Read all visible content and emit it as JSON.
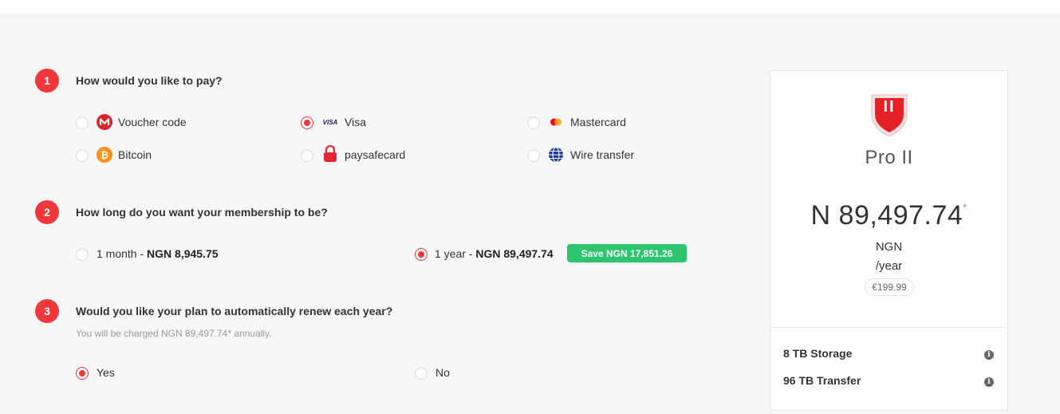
{
  "steps": [
    {
      "number": "1",
      "title": "How would you like to pay?"
    },
    {
      "number": "2",
      "title": "How long do you want your membership to be?"
    },
    {
      "number": "3",
      "title": "Would you like your plan to automatically renew each year?",
      "subtitle": "You will be charged NGN 89,497.74* annually."
    }
  ],
  "payment_methods": [
    {
      "label": "Voucher code",
      "icon": "mega-logo-icon",
      "selected": false
    },
    {
      "label": "Visa",
      "icon": "visa-logo-icon",
      "selected": true
    },
    {
      "label": "Mastercard",
      "icon": "mastercard-logo-icon",
      "selected": false
    },
    {
      "label": "Bitcoin",
      "icon": "bitcoin-icon",
      "selected": false
    },
    {
      "label": "paysafecard",
      "icon": "paysafecard-lock-icon",
      "selected": false
    },
    {
      "label": "Wire transfer",
      "icon": "globe-icon",
      "selected": false
    }
  ],
  "visa_text": "VISA",
  "durations": [
    {
      "label_prefix": "1 month - ",
      "price": "NGN 8,945.75",
      "selected": false
    },
    {
      "label_prefix": "1 year - ",
      "price": "NGN 89,497.74",
      "selected": true
    }
  ],
  "save_badge": "Save NGN 17,851.26",
  "renew": [
    {
      "label": "Yes",
      "selected": true
    },
    {
      "label": "No",
      "selected": false
    }
  ],
  "plan": {
    "logo_text": "II",
    "name": "Pro II",
    "price": "N 89,497.74",
    "price_mark": "*",
    "currency": "NGN",
    "period": "/year",
    "euro_price": "€199.99",
    "features": [
      {
        "label": "8 TB Storage"
      },
      {
        "label": "96 TB Transfer"
      }
    ],
    "info_glyph": "i"
  },
  "colors": {
    "accent": "#f0373a",
    "save_green": "#2dc46e",
    "background": "#f7f7f7"
  }
}
